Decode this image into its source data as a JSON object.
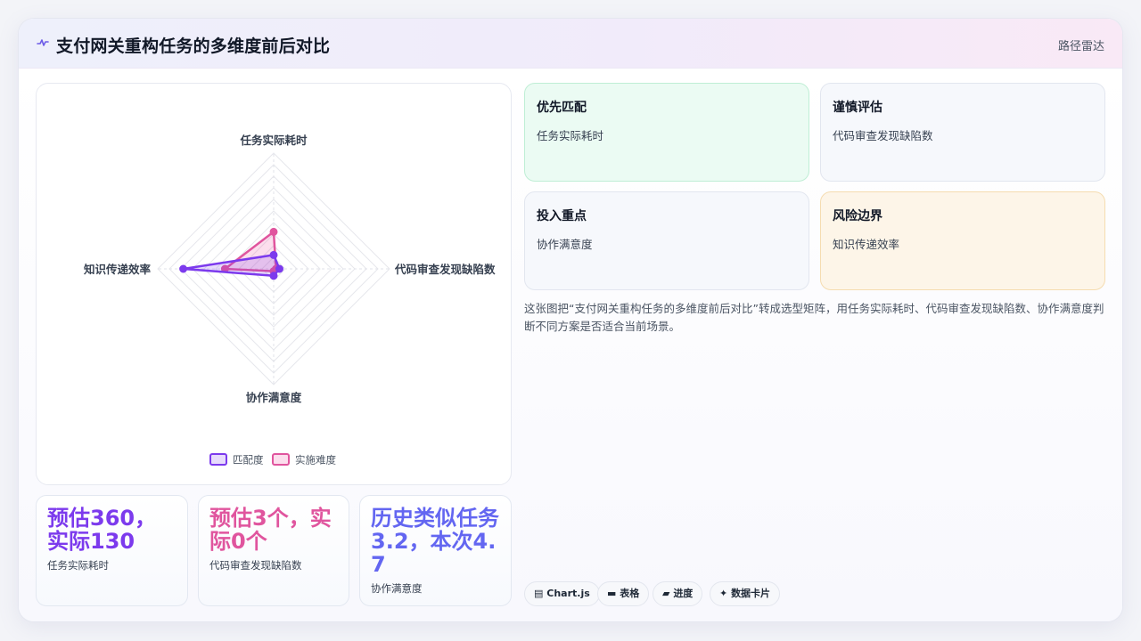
{
  "header": {
    "title": "支付网关重构任务的多维度前后对比",
    "icon": "activity-icon",
    "right_label": "路径雷达"
  },
  "chart_data": {
    "type": "radar",
    "axes": [
      "任务实际耗时",
      "代码审查发现缺陷数",
      "协作满意度",
      "知识传递效率"
    ],
    "rmax": 10,
    "grid_rings": 10,
    "series": [
      {
        "name": "匹配度",
        "values": [
          1.2,
          0.5,
          0.6,
          7.8
        ],
        "color": "#7c3aed",
        "fill": "rgba(124,58,237,0.18)"
      },
      {
        "name": "实施难度",
        "values": [
          3.2,
          0.2,
          0.2,
          4.2
        ],
        "color": "#e0559e",
        "fill": "rgba(236,72,153,0.18)"
      }
    ],
    "legend_position": "bottom"
  },
  "stats": [
    {
      "value": "预估360，实际130",
      "label": "任务实际耗时",
      "color": "#7c3aed"
    },
    {
      "value": "预估3个，实际0个",
      "label": "代码审查发现缺陷数",
      "color": "#e0559e"
    },
    {
      "value": "历史类似任务3.2，本次4.7",
      "label": "协作满意度",
      "color": "#6366f1"
    }
  ],
  "tiles": [
    {
      "title": "优先匹配",
      "sub": "任务实际耗时",
      "bg": "#ebfbf3",
      "border": "#bfeed5"
    },
    {
      "title": "谨慎评估",
      "sub": "代码审查发现缺陷数",
      "bg": "#f6f8fc",
      "border": "#e2e6ef"
    },
    {
      "title": "投入重点",
      "sub": "协作满意度",
      "bg": "#f6f8fc",
      "border": "#e2e6ef"
    },
    {
      "title": "风险边界",
      "sub": "知识传递效率",
      "bg": "#fdf5e8",
      "border": "#f5dcb0"
    }
  ],
  "description": "这张图把“支付网关重构任务的多维度前后对比”转成选型矩阵，用任务实际耗时、代码审查发现缺陷数、协作满意度判断不同方案是否适合当前场景。",
  "chips": [
    {
      "icon": "chart-icon",
      "glyph": "▤",
      "label": "Chart.js"
    },
    {
      "icon": "table-icon",
      "glyph": "▬",
      "label": "表格"
    },
    {
      "icon": "progress-icon",
      "glyph": "▰",
      "label": "进度"
    },
    {
      "icon": "sparkle-icon",
      "glyph": "✦",
      "label": "数据卡片"
    }
  ]
}
